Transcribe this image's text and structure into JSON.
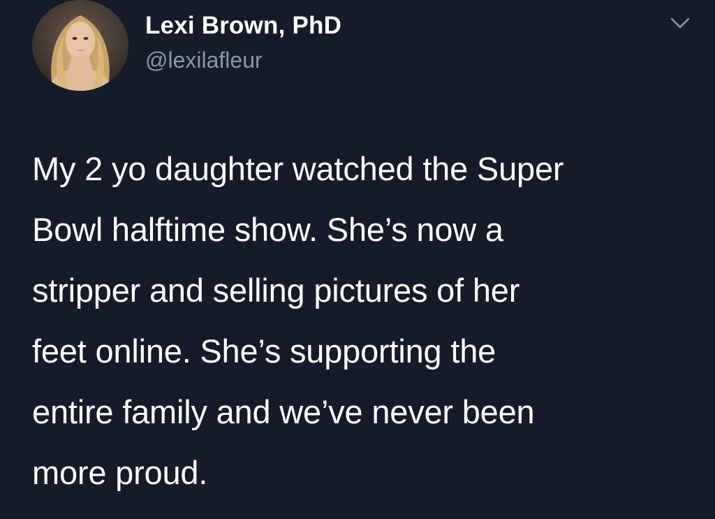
{
  "tweet": {
    "author": {
      "display_name": "Lexi Brown, PhD",
      "handle": "@lexilafleur",
      "avatar_icon": "profile-photo"
    },
    "menu_icon": "chevron-down-icon",
    "text_lines": [
      "My 2 yo daughter watched the Super",
      "Bowl halftime show. She’s now a",
      "stripper and selling pictures of her",
      "feet online. She’s supporting the",
      "entire family and we’ve never been",
      "more proud."
    ]
  },
  "colors": {
    "background": "#151b28",
    "primary_text": "#ffffff",
    "secondary_text": "#8899a6"
  }
}
